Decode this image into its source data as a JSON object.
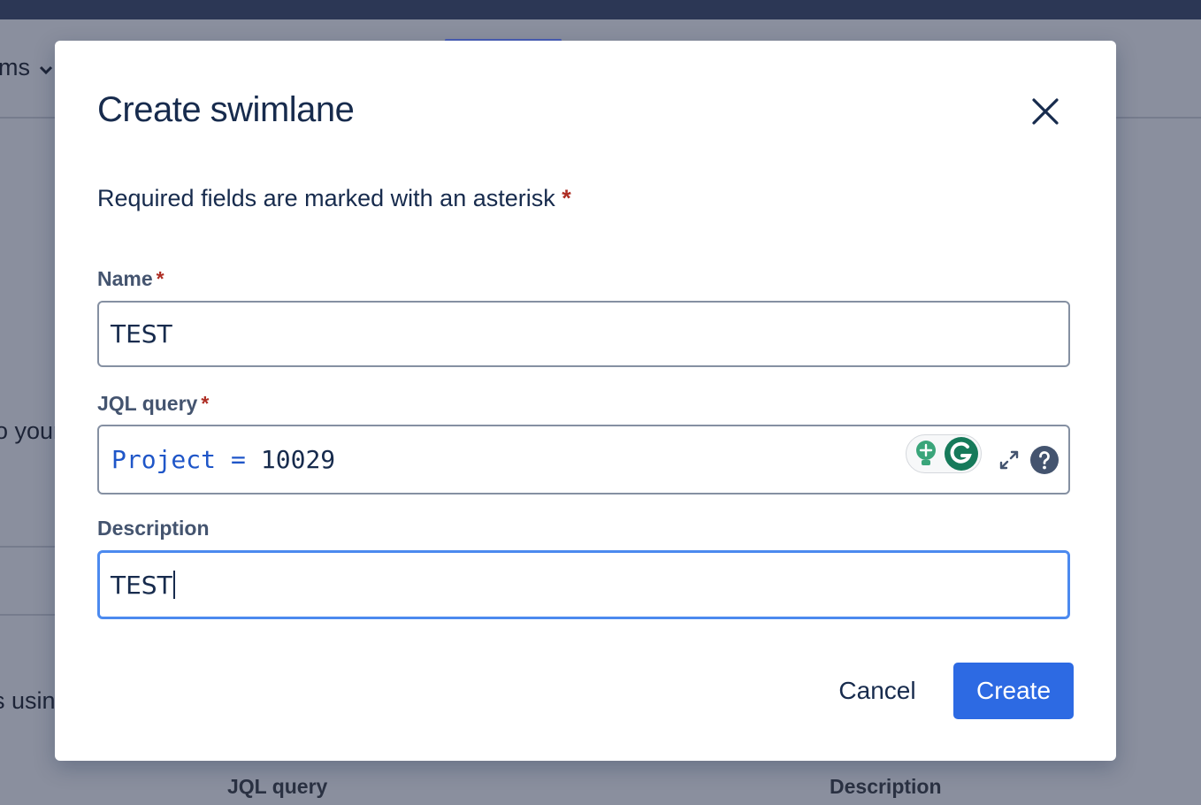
{
  "background": {
    "nav_fragment": "ms",
    "text_fragment_1": "o your",
    "text_fragment_2": "s usin",
    "columns": {
      "jql_query": "JQL query",
      "description": "Description"
    }
  },
  "modal": {
    "title": "Create swimlane",
    "required_note": "Required fields are marked with an asterisk",
    "asterisk": "*",
    "fields": {
      "name": {
        "label": "Name",
        "value": "TEST"
      },
      "jql": {
        "label": "JQL query",
        "field": "Project",
        "operator": "=",
        "value": "10029"
      },
      "description": {
        "label": "Description",
        "value": "TEST"
      }
    },
    "actions": {
      "cancel": "Cancel",
      "create": "Create"
    }
  },
  "icons": {
    "close": "close-icon",
    "grammarly_suggest": "lightbulb-icon",
    "grammarly": "grammarly-icon",
    "expand": "expand-icon",
    "help": "help-icon"
  },
  "colors": {
    "primary": "#2d6ae3",
    "required": "#ae2e24",
    "focus": "#4c8aef",
    "jql_keyword": "#1f56c8"
  }
}
